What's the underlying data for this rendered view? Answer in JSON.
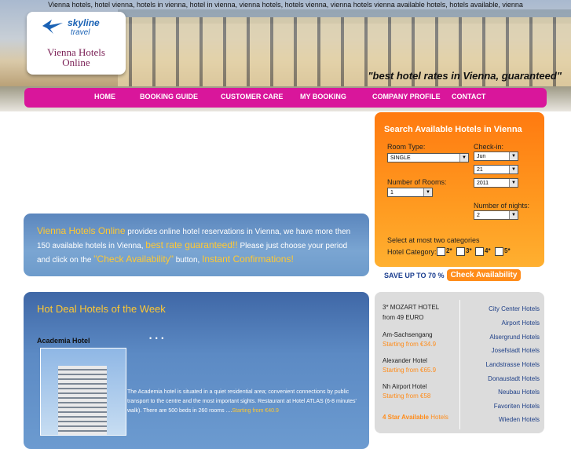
{
  "header": {
    "top_keywords": "Vienna hotels, hotel vienna, hotels in vienna, hotel in vienna, vienna hotels, hotels vienna, vienna hotels vienna available hotels, hotels available, vienna",
    "logo_brand": "skyline",
    "logo_brand_sub": "travel",
    "logo_title_line1": "Vienna Hotels",
    "logo_title_line2": "Online",
    "tagline": "\"best hotel rates in Vienna, guaranteed\""
  },
  "nav": {
    "items": [
      "HOME",
      "BOOKING GUIDE",
      "CUSTOMER CARE",
      "MY BOOKING",
      "COMPANY PROFILE",
      "CONTACT"
    ]
  },
  "intro": {
    "brand": "Vienna Hotels Online",
    "text1": " provides online hotel reservations in Vienna, we have more then 150 available hotels in Vienna, ",
    "highlight1": "best rate guaranteed!!",
    "text2": " Please just choose your period and click on the ",
    "highlight2": "\"Check Availability\"",
    "text3": " button, ",
    "highlight3": "Instant Confirmations!"
  },
  "search": {
    "title": "Search Available Hotels in Vienna",
    "room_type_label": "Room Type:",
    "room_type_value": "SINGLE",
    "checkin_label": "Check-in:",
    "checkin_month": "Jun",
    "checkin_day": "21",
    "checkin_year": "2011",
    "rooms_label": "Number of Rooms:",
    "rooms_value": "1",
    "nights_label": "Number of nights:",
    "nights_value": "2",
    "categories_note": "Select at most two categories",
    "category_label": "Hotel Category:",
    "categories": [
      "2*",
      "3*",
      "4*",
      "5*"
    ],
    "save_text": "SAVE UP TO 70 %",
    "check_button": "Check Availability"
  },
  "deals": {
    "title": "Hot Deal Hotels of the Week",
    "hotel_name": "Academia Hotel",
    "dots": "• • •",
    "description": "The Academia hotel is situated in a quiet residential area; convenient connections by public transport to the centre and the most important sights. Restaurant at Hotel ATLAS (6-8 minutes' walk). There are 500 beds in 260 rooms ....",
    "price": "Starting from €40.9"
  },
  "hotels_box": {
    "left": [
      {
        "name": "3* MOZART HOTEL",
        "sub": "from 49 EURO"
      },
      {
        "name": "Am-Sachsengang",
        "sub": "Starting from €34.9"
      },
      {
        "name": "Alexander Hotel",
        "sub": "Starting from €65.9"
      },
      {
        "name": "Nh Airport Hotel",
        "sub": "Starting from €58"
      }
    ],
    "four_star_bold": "4 Star Available",
    "four_star_rest": " Hotels",
    "right": [
      "City Center Hotels",
      "Airport Hotels",
      "Alsergrund Hotels",
      "Josefstadt Hotels",
      "Landstrasse Hotels",
      "Donaustadt Hotels",
      "Neubau Hotels",
      "Favoriten Hotels",
      "Wieden Hotels"
    ]
  },
  "colors": {
    "nav": "#d9169b",
    "search_panel": "#ff8c1a",
    "accent_text": "#ffc832",
    "panel_blue": "#5c8ac4"
  }
}
